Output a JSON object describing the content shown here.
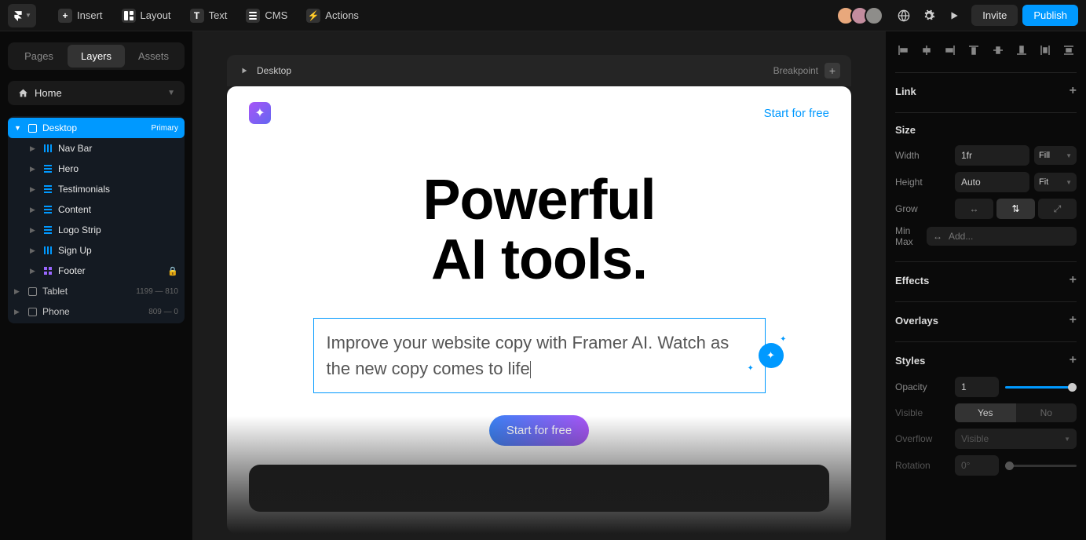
{
  "topbar": {
    "tools": {
      "insert": "Insert",
      "layout": "Layout",
      "text": "Text",
      "cms": "CMS",
      "actions": "Actions"
    },
    "invite": "Invite",
    "publish": "Publish",
    "avatars": [
      "#e8a87c",
      "#c38d9e",
      "#8e8d8a"
    ]
  },
  "leftPanel": {
    "tabs": {
      "pages": "Pages",
      "layers": "Layers",
      "assets": "Assets"
    },
    "page": "Home",
    "tree": {
      "desktop": {
        "label": "Desktop",
        "badge": "Primary"
      },
      "children": [
        {
          "name": "Nav Bar",
          "type": "h"
        },
        {
          "name": "Hero",
          "type": "v"
        },
        {
          "name": "Testimonials",
          "type": "v"
        },
        {
          "name": "Content",
          "type": "v"
        },
        {
          "name": "Logo Strip",
          "type": "v"
        },
        {
          "name": "Sign Up",
          "type": "h"
        },
        {
          "name": "Footer",
          "type": "grid",
          "locked": true
        }
      ],
      "tablet": {
        "label": "Tablet",
        "dims": "1199 — 810"
      },
      "phone": {
        "label": "Phone",
        "dims": "809 — 0"
      }
    }
  },
  "canvas": {
    "frameLabel": "Desktop",
    "breakpointLabel": "Breakpoint",
    "nav": {
      "cta": "Start for free"
    },
    "hero": {
      "titleLine1": "Powerful",
      "titleLine2": "AI tools.",
      "subtitle": "Improve your website copy with Framer AI. Watch as the new copy comes to life",
      "cta": "Start for free"
    }
  },
  "rightPanel": {
    "link": {
      "title": "Link"
    },
    "size": {
      "title": "Size",
      "widthLabel": "Width",
      "widthValue": "1fr",
      "widthMode": "Fill",
      "heightLabel": "Height",
      "heightValue": "Auto",
      "heightMode": "Fit",
      "growLabel": "Grow",
      "minmaxLabel": "Min Max",
      "minmaxPlaceholder": "Add..."
    },
    "effects": {
      "title": "Effects"
    },
    "overlays": {
      "title": "Overlays"
    },
    "styles": {
      "title": "Styles",
      "opacityLabel": "Opacity",
      "opacityValue": "1",
      "visibleLabel": "Visible",
      "visibleYes": "Yes",
      "visibleNo": "No",
      "overflowLabel": "Overflow",
      "overflowValue": "Visible",
      "rotationLabel": "Rotation",
      "rotationValue": "0°"
    }
  }
}
